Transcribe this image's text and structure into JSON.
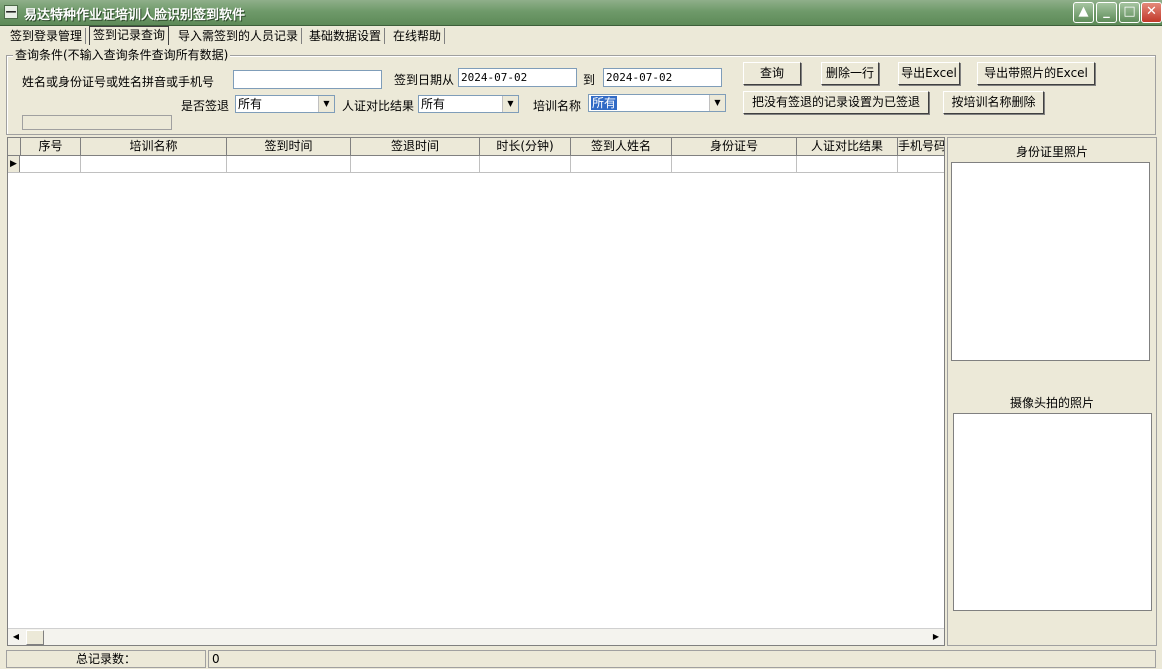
{
  "window": {
    "title": "易达特种作业证培训人脸识别签到软件",
    "sysmenu_glyph": "—",
    "minimize_glyph": "▲",
    "restore_glyph": "_",
    "maximize_glyph": "□",
    "close_glyph": "✕"
  },
  "tabs": [
    {
      "label": "签到登录管理"
    },
    {
      "label": "签到记录查询"
    },
    {
      "label": "导入需签到的人员记录"
    },
    {
      "label": "基础数据设置"
    },
    {
      "label": "在线帮助"
    }
  ],
  "query": {
    "legend": "查询条件(不输入查询条件查询所有数据)",
    "search_label": "姓名或身份证号或姓名拼音或手机号",
    "search_value": "",
    "date_from_label": "签到日期从",
    "date_from_value": "2024-07-02",
    "date_to_label": "到",
    "date_to_value": "2024-07-02",
    "signout_label": "是否签退",
    "signout_value": "所有",
    "compare_label": "人证对比结果",
    "compare_value": "所有",
    "training_label": "培训名称",
    "training_value": "所有"
  },
  "buttons": {
    "query": "查询",
    "delete_row": "删除一行",
    "export_excel": "导出Excel",
    "export_photo_excel": "导出带照片的Excel",
    "set_signed_out": "把没有签退的记录设置为已签退",
    "delete_by_training": "按培训名称删除"
  },
  "grid": {
    "columns": [
      "序号",
      "培训名称",
      "签到时间",
      "签退时间",
      "时长(分钟)",
      "签到人姓名",
      "身份证号",
      "人证对比结果",
      "手机号码"
    ],
    "row_indicator": "▶"
  },
  "photos": {
    "id_photo_label": "身份证里照片",
    "camera_photo_label": "摄像头拍的照片"
  },
  "status": {
    "total_label": "总记录数：",
    "total_value": "0"
  }
}
